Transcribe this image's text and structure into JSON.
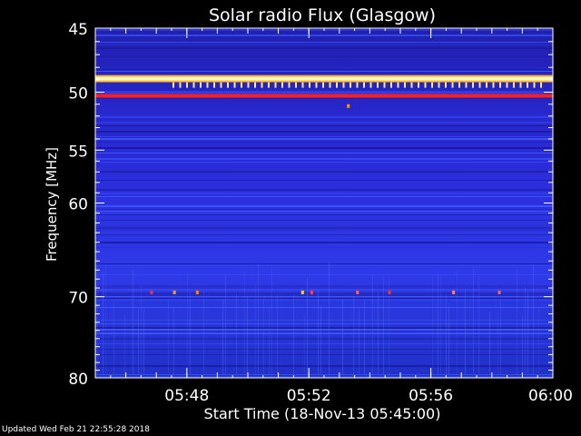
{
  "chart_data": {
    "type": "heatmap",
    "title": "Solar radio Flux (Glasgow)",
    "xlabel": "Start Time (18-Nov-13 05:45:00)",
    "ylabel": "Frequency [MHz]",
    "x_ticks": [
      "05:48",
      "05:52",
      "05:56",
      "06:00"
    ],
    "y_ticks": [
      45,
      50,
      55,
      60,
      70,
      80
    ],
    "xlim": [
      "05:45",
      "06:00"
    ],
    "ylim": [
      45,
      80
    ],
    "y_scale": "log",
    "grid": false,
    "colormap": [
      "#1a1aa0",
      "#2a2ae0",
      "#3a5aff",
      "#ffffff",
      "#ffe060",
      "#ff2020"
    ],
    "features": [
      {
        "kind": "bright-band",
        "frequency": 48.9,
        "colors": [
          "#ff8800",
          "#ffffff"
        ]
      },
      {
        "kind": "bright-band",
        "frequency": 50.3,
        "colors": [
          "#ff2020"
        ]
      }
    ]
  },
  "footer": {
    "updated": "Updated Wed Feb 21 22:55:28 2018"
  }
}
